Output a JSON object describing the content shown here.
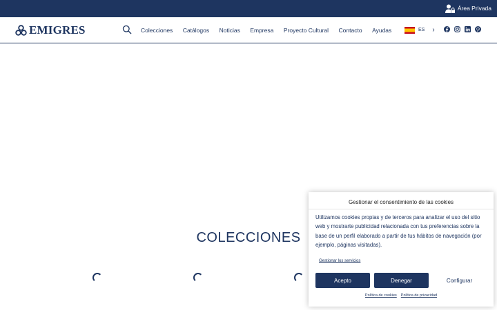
{
  "topbar": {
    "private_area_label": "Área Privada"
  },
  "header": {
    "logo_text": "EMIGRES",
    "nav_items": [
      "Colecciones",
      "Catálogos",
      "Noticias",
      "Empresa",
      "Proyecto Cultural",
      "Contacto",
      "Ayudas"
    ],
    "language": {
      "code": "ES"
    },
    "social": [
      "facebook-icon",
      "instagram-icon",
      "linkedin-icon",
      "pinterest-icon"
    ]
  },
  "main": {
    "section_title": "COLECCIONES"
  },
  "cookie_banner": {
    "title": "Gestionar el consentimiento de las cookies",
    "body": "Utilizamos cookies propias y de terceros para analizar el uso del sitio web y mostrarte publicidad relacionada con tus preferencias sobre la base de un perfil elaborado a partir de tus hábitos de navegación (por ejemplo, páginas visitadas).",
    "manage_link": "Gestionar los servicios",
    "accept_label": "Acepto",
    "deny_label": "Denegar",
    "configure_label": "Configurar",
    "cookie_policy_link": "Política de cookies",
    "privacy_policy_link": "Política de privacidad"
  },
  "colors": {
    "primary": "#1e3560",
    "background": "#ffffff"
  }
}
